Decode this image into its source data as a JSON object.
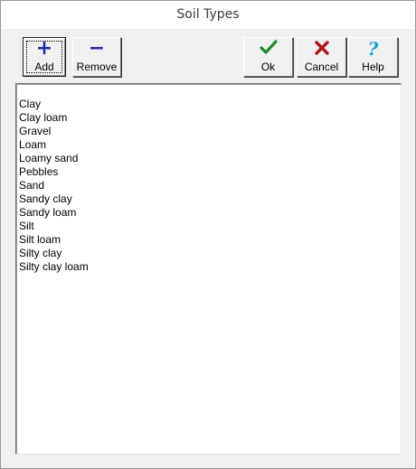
{
  "window": {
    "title": "Soil Types"
  },
  "toolbar": {
    "add": {
      "label": "Add",
      "icon": "plus-icon"
    },
    "remove": {
      "label": "Remove",
      "icon": "minus-icon"
    },
    "ok": {
      "label": "Ok",
      "icon": "checkmark-icon",
      "color": "#1e8a2a"
    },
    "cancel": {
      "label": "Cancel",
      "icon": "x-icon",
      "color": "#b01616"
    },
    "help": {
      "label": "Help",
      "icon": "question-mark-icon",
      "color": "#1aa7d6"
    }
  },
  "soil_list": {
    "items": [
      "Clay",
      "Clay loam",
      "Gravel",
      "Loam",
      "Loamy sand",
      "Pebbles",
      "Sand",
      "Sandy clay",
      "Sandy loam",
      "Silt",
      "Silt loam",
      "Silty clay",
      "Silty clay loam"
    ]
  }
}
